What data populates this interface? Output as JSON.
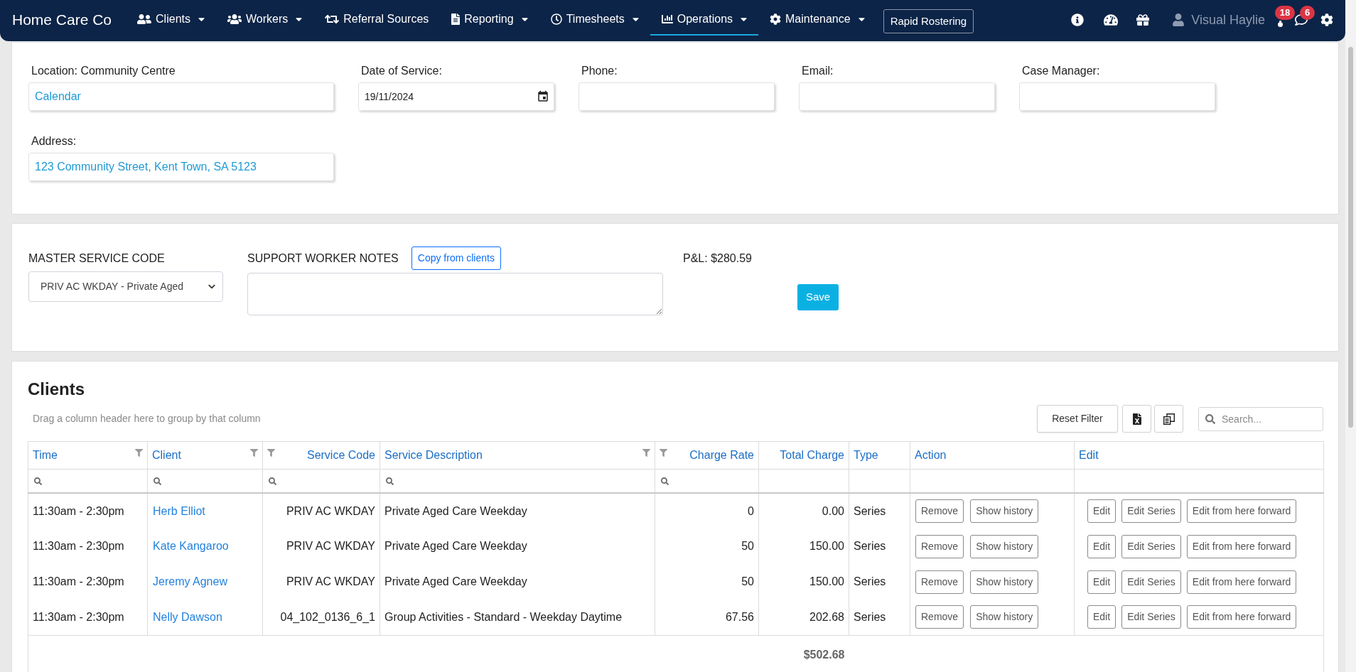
{
  "navbar": {
    "brand": "Home Care Co",
    "items": [
      {
        "label": "Clients",
        "dropdown": true,
        "selected": false
      },
      {
        "label": "Workers",
        "dropdown": true,
        "selected": false
      },
      {
        "label": "Referral Sources",
        "dropdown": false,
        "selected": false
      },
      {
        "label": "Reporting",
        "dropdown": true,
        "selected": false
      },
      {
        "label": "Timesheets",
        "dropdown": true,
        "selected": false
      },
      {
        "label": "Operations",
        "dropdown": true,
        "selected": true
      },
      {
        "label": "Maintenance",
        "dropdown": true,
        "selected": false
      }
    ],
    "action_button": "Rapid Rostering",
    "user": "Visual Haylie",
    "alerts_count": "18",
    "messages_count": "6"
  },
  "details": {
    "fields": [
      {
        "label": "Location: Community Centre",
        "value": "Calendar",
        "kind": "link"
      },
      {
        "label": "Date of Service:",
        "value": "19/11/2024",
        "kind": "date"
      },
      {
        "label": "Phone:",
        "kind": "text"
      },
      {
        "label": "Email:",
        "kind": "text"
      },
      {
        "label": "Case Manager:",
        "kind": "text"
      },
      {
        "label": "Address:",
        "value": "123 Community Street, Kent Town, SA 5123",
        "kind": "link"
      }
    ]
  },
  "service": {
    "master_label": "MASTER SERVICE CODE",
    "master_value": "PRIV AC WKDAY - Private Aged",
    "notes_label": "SUPPORT WORKER NOTES",
    "copy_button": "Copy from clients",
    "profit_loss": "P&L: $280.59",
    "save_button": "Save"
  },
  "clients": {
    "title": "Clients",
    "group_hint": "Drag a column header here to group by that column",
    "reset_button": "Reset Filter",
    "search": {
      "placeholder": "Search..."
    },
    "columns": [
      {
        "label": "Time",
        "filterable": true
      },
      {
        "label": "Client",
        "filterable": true
      },
      {
        "label": "Service Code",
        "filterable": true
      },
      {
        "label": "Service Description",
        "filterable": true
      },
      {
        "label": "Charge Rate",
        "filterable": true
      },
      {
        "label": "Total Charge",
        "filterable": false
      },
      {
        "label": "Type",
        "filterable": false
      },
      {
        "label": "Action",
        "filterable": false
      },
      {
        "label": "Edit",
        "filterable": false
      }
    ],
    "rows": [
      {
        "time": "11:30am - 2:30pm",
        "client": "Herb Elliot",
        "service_code": "PRIV AC WKDAY",
        "service_description": "Private Aged Care Weekday",
        "charge_rate": "0",
        "total_charge": "0.00",
        "type": "Series",
        "actions": [
          "Remove",
          "Show history"
        ],
        "edits": [
          "Edit",
          "Edit Series",
          "Edit from here forward"
        ]
      },
      {
        "time": "11:30am - 2:30pm",
        "client": "Kate Kangaroo",
        "service_code": "PRIV AC WKDAY",
        "service_description": "Private Aged Care Weekday",
        "charge_rate": "50",
        "total_charge": "150.00",
        "type": "Series",
        "actions": [
          "Remove",
          "Show history"
        ],
        "edits": [
          "Edit",
          "Edit Series",
          "Edit from here forward"
        ]
      },
      {
        "time": "11:30am - 2:30pm",
        "client": "Jeremy Agnew",
        "service_code": "PRIV AC WKDAY",
        "service_description": "Private Aged Care Weekday",
        "charge_rate": "50",
        "total_charge": "150.00",
        "type": "Series",
        "actions": [
          "Remove",
          "Show history"
        ],
        "edits": [
          "Edit",
          "Edit Series",
          "Edit from here forward"
        ]
      },
      {
        "time": "11:30am - 2:30pm",
        "client": "Nelly Dawson",
        "service_code": "04_102_0136_6_1",
        "service_description": "Group Activities - Standard - Weekday Daytime",
        "charge_rate": "67.56",
        "total_charge": "202.68",
        "type": "Series",
        "actions": [
          "Remove",
          "Show history"
        ],
        "edits": [
          "Edit",
          "Edit Series",
          "Edit from here forward"
        ]
      }
    ],
    "total": "$502.68"
  }
}
